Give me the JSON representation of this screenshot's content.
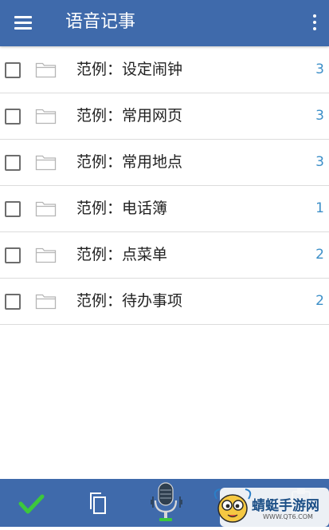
{
  "app_bar": {
    "title": "语音记事",
    "menu_icon": "hamburger-menu-icon",
    "overflow_icon": "more-vert-icon",
    "bg_color": "#3f6aab"
  },
  "notebooks": [
    {
      "label": "范例：设定闹钟",
      "count": "3"
    },
    {
      "label": "范例：常用网页",
      "count": "3"
    },
    {
      "label": "范例：常用地点",
      "count": "3"
    },
    {
      "label": "范例：电话簿",
      "count": "1"
    },
    {
      "label": "范例：点菜单",
      "count": "2"
    },
    {
      "label": "范例：待办事项",
      "count": "2"
    }
  ],
  "bottom_bar": {
    "buttons": [
      "check-icon",
      "copy-icon",
      "microphone-icon",
      "clipboard-icon"
    ],
    "accent_color": "#3cc83c"
  },
  "watermark": {
    "text": "蜻蜓手游网",
    "url": "WWW.QT6.COM"
  }
}
